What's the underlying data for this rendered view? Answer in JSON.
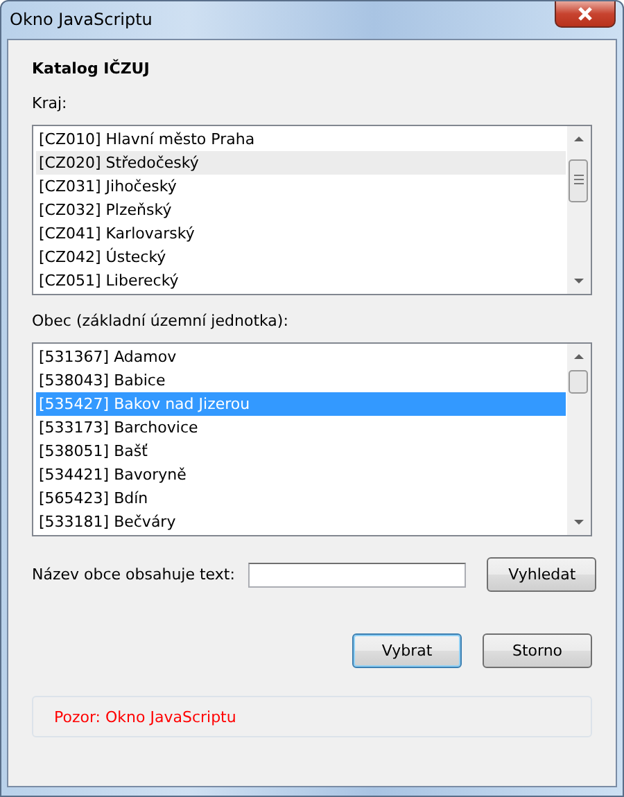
{
  "window": {
    "title": "Okno JavaScriptu"
  },
  "heading": "Katalog IČZUJ",
  "lists": [
    {
      "label": "Kraj:",
      "focused": false,
      "items": [
        {
          "text": "[CZ010] Hlavní město Praha",
          "selected": false
        },
        {
          "text": "[CZ020] Středočeský",
          "selected": true
        },
        {
          "text": "[CZ031] Jihočeský",
          "selected": false
        },
        {
          "text": "[CZ032] Plzeňský",
          "selected": false
        },
        {
          "text": "[CZ041] Karlovarský",
          "selected": false
        },
        {
          "text": "[CZ042] Ústecký",
          "selected": false
        },
        {
          "text": "[CZ051] Liberecký",
          "selected": false
        }
      ]
    },
    {
      "label": "Obec (základní územní jednotka):",
      "focused": true,
      "items": [
        {
          "text": "[531367] Adamov",
          "selected": false
        },
        {
          "text": "[538043] Babice",
          "selected": false
        },
        {
          "text": "[535427] Bakov nad Jizerou",
          "selected": true
        },
        {
          "text": "[533173] Barchovice",
          "selected": false
        },
        {
          "text": "[538051] Bašť",
          "selected": false
        },
        {
          "text": "[534421] Bavoryně",
          "selected": false
        },
        {
          "text": "[565423] Bdín",
          "selected": false
        },
        {
          "text": "[533181] Bečváry",
          "selected": false
        }
      ]
    }
  ],
  "search": {
    "label": "Název obce obsahuje text:",
    "button": "Vyhledat"
  },
  "buttons": [
    {
      "label": "Vybrat",
      "default": true
    },
    {
      "label": "Storno",
      "default": false
    }
  ],
  "status": "Pozor: Okno JavaScriptu"
}
